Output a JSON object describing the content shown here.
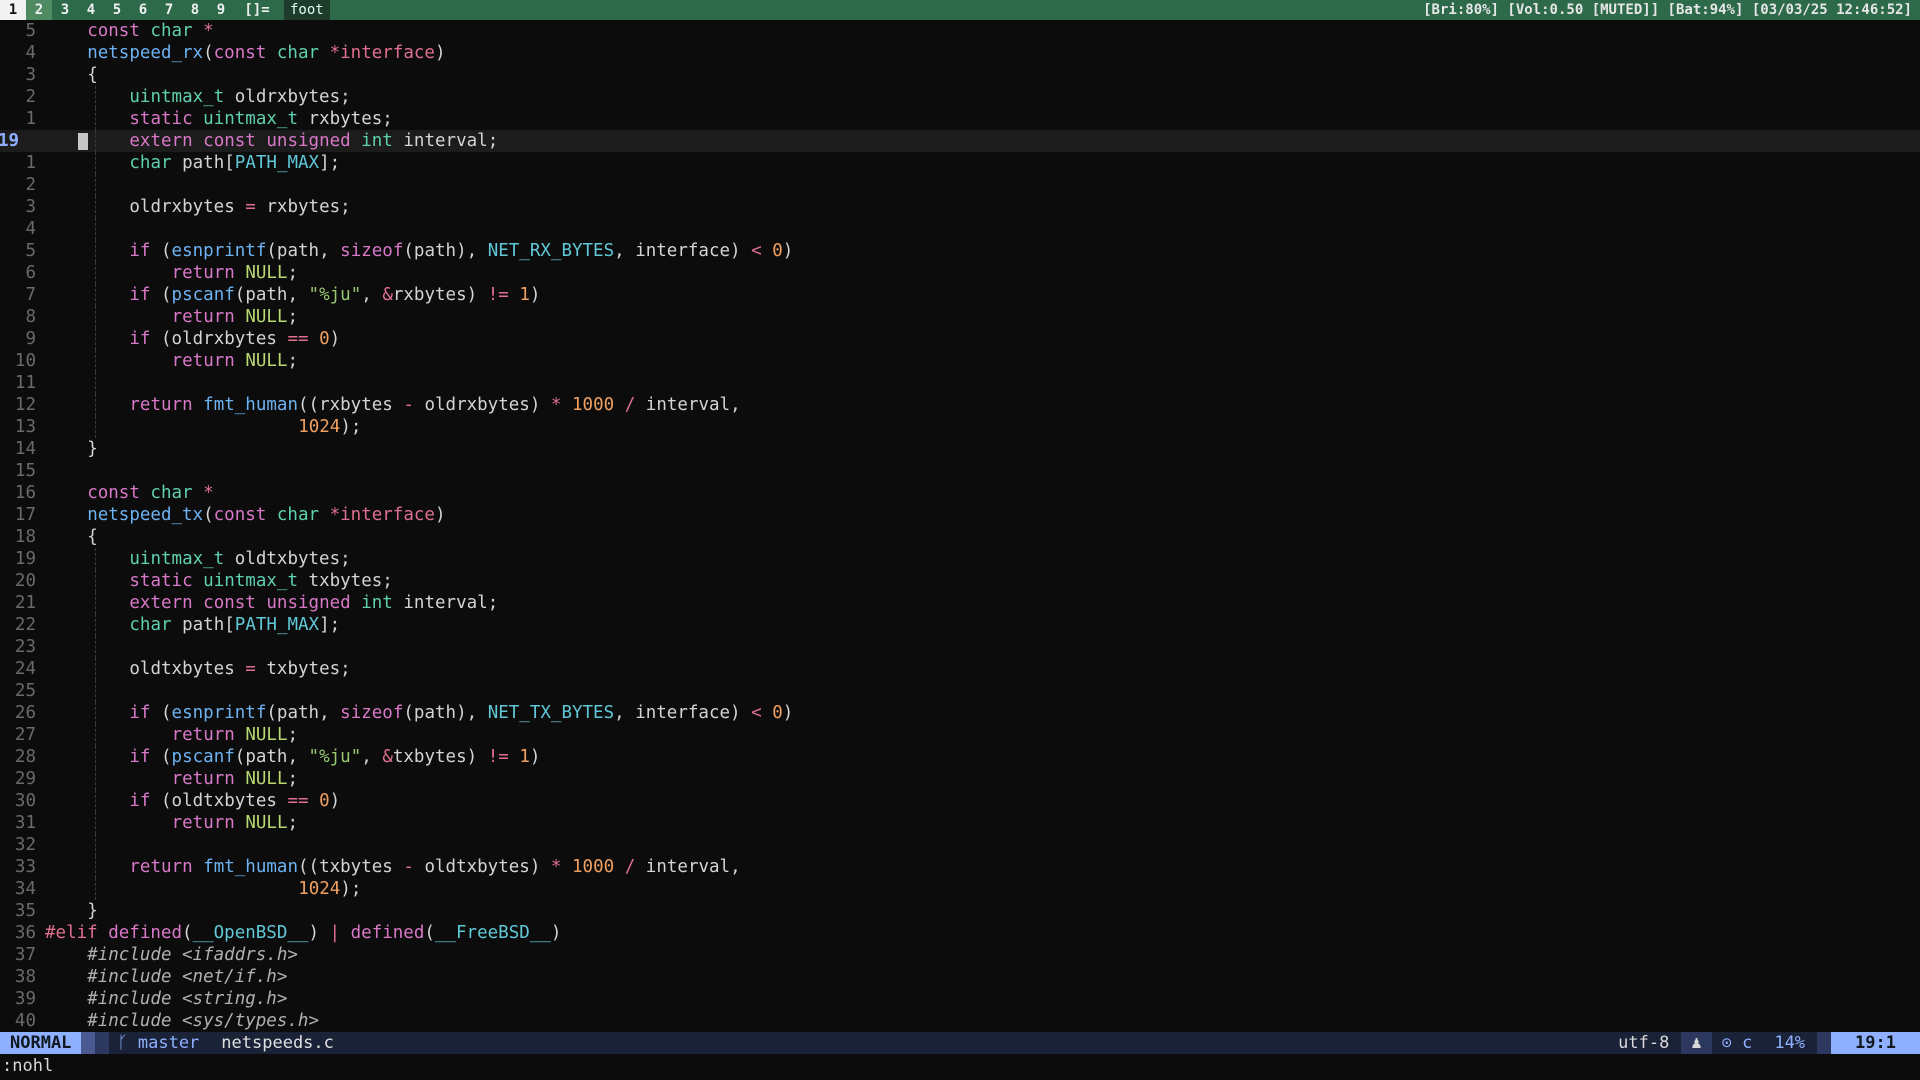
{
  "topbar": {
    "workspaces": [
      "1",
      "2",
      "3",
      "4",
      "5",
      "6",
      "7",
      "8",
      "9"
    ],
    "active_workspace": "1",
    "layout": "[]=",
    "window_title": "foot",
    "status": "[Bri:80%] [Vol:0.50 [MUTED]] [Bat:94%] [03/03/25 12:46:52]"
  },
  "editor": {
    "lines": [
      {
        "n": "5",
        "t": "const char *"
      },
      {
        "n": "4",
        "t": "netspeed_rx(const char *interface)"
      },
      {
        "n": "3",
        "t": "{"
      },
      {
        "n": "2",
        "t": "uintmax_t oldrxbytes;"
      },
      {
        "n": "1",
        "t": "static uintmax_t rxbytes;"
      },
      {
        "n": "19",
        "t": "extern const unsigned int interval;"
      },
      {
        "n": "1",
        "t": "char path[PATH_MAX];"
      },
      {
        "n": "2",
        "t": ""
      },
      {
        "n": "3",
        "t": "oldrxbytes = rxbytes;"
      },
      {
        "n": "4",
        "t": ""
      },
      {
        "n": "5",
        "t": "if (esnprintf(path, sizeof(path), NET_RX_BYTES, interface) < 0)"
      },
      {
        "n": "6",
        "t": "return NULL;"
      },
      {
        "n": "7",
        "t": "if (pscanf(path, \"%ju\", &rxbytes) != 1)"
      },
      {
        "n": "8",
        "t": "return NULL;"
      },
      {
        "n": "9",
        "t": "if (oldrxbytes == 0)"
      },
      {
        "n": "10",
        "t": "return NULL;"
      },
      {
        "n": "11",
        "t": ""
      },
      {
        "n": "12",
        "t": "return fmt_human((rxbytes - oldrxbytes) * 1000 / interval,"
      },
      {
        "n": "13",
        "t": "1024);"
      },
      {
        "n": "14",
        "t": "}"
      },
      {
        "n": "15",
        "t": ""
      },
      {
        "n": "16",
        "t": "const char *"
      },
      {
        "n": "17",
        "t": "netspeed_tx(const char *interface)"
      },
      {
        "n": "18",
        "t": "{"
      },
      {
        "n": "19",
        "t": "uintmax_t oldtxbytes;"
      },
      {
        "n": "20",
        "t": "static uintmax_t txbytes;"
      },
      {
        "n": "21",
        "t": "extern const unsigned int interval;"
      },
      {
        "n": "22",
        "t": "char path[PATH_MAX];"
      },
      {
        "n": "23",
        "t": ""
      },
      {
        "n": "24",
        "t": "oldtxbytes = txbytes;"
      },
      {
        "n": "25",
        "t": ""
      },
      {
        "n": "26",
        "t": "if (esnprintf(path, sizeof(path), NET_TX_BYTES, interface) < 0)"
      },
      {
        "n": "27",
        "t": "return NULL;"
      },
      {
        "n": "28",
        "t": "if (pscanf(path, \"%ju\", &txbytes) != 1)"
      },
      {
        "n": "29",
        "t": "return NULL;"
      },
      {
        "n": "30",
        "t": "if (oldtxbytes == 0)"
      },
      {
        "n": "31",
        "t": "return NULL;"
      },
      {
        "n": "32",
        "t": ""
      },
      {
        "n": "33",
        "t": "return fmt_human((txbytes - oldtxbytes) * 1000 / interval,"
      },
      {
        "n": "34",
        "t": "1024);"
      },
      {
        "n": "35",
        "t": "}"
      },
      {
        "n": "36",
        "t": "#elif defined(__OpenBSD__) | defined(__FreeBSD__)"
      },
      {
        "n": "37",
        "t": "#include <ifaddrs.h>"
      },
      {
        "n": "38",
        "t": "#include <net/if.h>"
      },
      {
        "n": "39",
        "t": "#include <string.h>"
      },
      {
        "n": "40",
        "t": "#include <sys/types.h>"
      }
    ]
  },
  "statusline": {
    "mode": "NORMAL",
    "branch_icon": "git-branch-icon",
    "branch": "master",
    "filename": "netspeeds.c",
    "encoding": "utf-8",
    "os_icon": "linux-penguin-icon",
    "filetype_icon": "c-lang-icon",
    "filetype": "c",
    "percent": "14%",
    "position": "19:1"
  },
  "cmdline": ":nohl",
  "colors": {
    "topbar_bg": "#2d6a4a",
    "accent": "#8fb0ff",
    "keyword": "#d978c8",
    "type": "#5fd0b0",
    "function": "#6db3f2",
    "string": "#98c870",
    "number": "#f0a060",
    "operator": "#e07090"
  }
}
